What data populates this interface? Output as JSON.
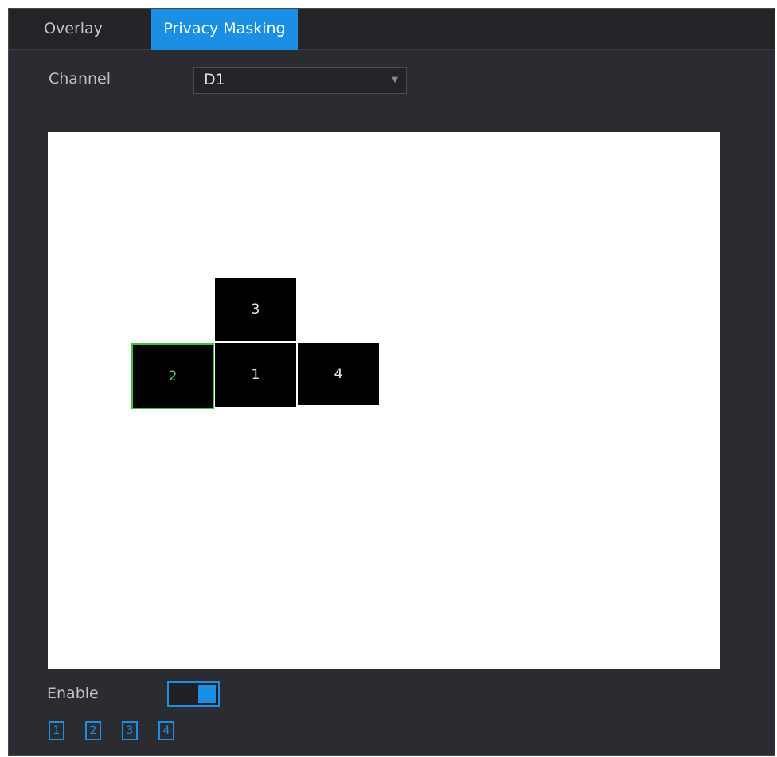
{
  "tabs": [
    {
      "label": "Overlay"
    },
    {
      "label": "Privacy Masking"
    }
  ],
  "channel": {
    "label": "Channel",
    "value": "D1"
  },
  "masks": [
    {
      "label": "3"
    },
    {
      "label": "2"
    },
    {
      "label": "1"
    },
    {
      "label": "4"
    }
  ],
  "enable": {
    "label": "Enable",
    "state": "on"
  },
  "region_buttons": [
    {
      "label": "1"
    },
    {
      "label": "2"
    },
    {
      "label": "3"
    },
    {
      "label": "4"
    }
  ],
  "colors": {
    "accent": "#1a8fe3",
    "selected_mask": "#3fc43f",
    "background": "#2a2c31"
  },
  "icons": {
    "dropdown": "chevron-down-icon"
  }
}
